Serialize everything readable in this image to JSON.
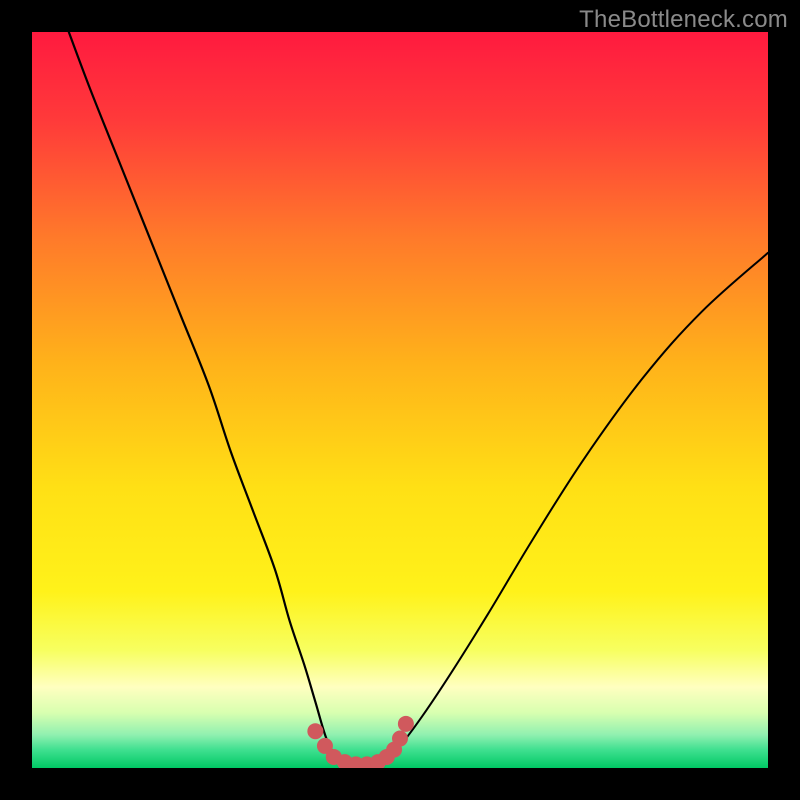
{
  "watermark": "TheBottleneck.com",
  "chart_data": {
    "type": "line",
    "title": "",
    "xlabel": "",
    "ylabel": "",
    "xlim": [
      0,
      100
    ],
    "ylim": [
      0,
      100
    ],
    "grid": false,
    "legend": false,
    "background_gradient": {
      "stops": [
        {
          "pos": 0.0,
          "color": "#ff1a3f"
        },
        {
          "pos": 0.12,
          "color": "#ff3a3a"
        },
        {
          "pos": 0.28,
          "color": "#ff7a2a"
        },
        {
          "pos": 0.45,
          "color": "#ffb21a"
        },
        {
          "pos": 0.62,
          "color": "#ffe015"
        },
        {
          "pos": 0.76,
          "color": "#fff21a"
        },
        {
          "pos": 0.84,
          "color": "#f7ff60"
        },
        {
          "pos": 0.89,
          "color": "#ffffc0"
        },
        {
          "pos": 0.925,
          "color": "#d8ffb0"
        },
        {
          "pos": 0.955,
          "color": "#90f0b0"
        },
        {
          "pos": 0.975,
          "color": "#40e090"
        },
        {
          "pos": 1.0,
          "color": "#00c864"
        }
      ]
    },
    "series": [
      {
        "name": "left-curve",
        "stroke": "#000000",
        "width": 2.2,
        "x": [
          5,
          8,
          12,
          16,
          20,
          24,
          27,
          30,
          33,
          35,
          37,
          38.5,
          40,
          41.5
        ],
        "values": [
          100,
          92,
          82,
          72,
          62,
          52,
          43,
          35,
          27,
          20,
          14,
          9,
          4,
          1
        ]
      },
      {
        "name": "right-curve",
        "stroke": "#000000",
        "width": 2.0,
        "x": [
          48,
          50,
          53,
          57,
          62,
          68,
          75,
          83,
          91,
          100
        ],
        "values": [
          1,
          3,
          7,
          13,
          21,
          31,
          42,
          53,
          62,
          70
        ]
      },
      {
        "name": "valley-dots",
        "type": "scatter",
        "stroke": "#d0595d",
        "fill": "#d0595d",
        "radius": 8,
        "x": [
          38.5,
          39.8,
          41,
          42.5,
          44,
          45.5,
          47,
          48.2,
          49.2,
          50,
          50.8
        ],
        "values": [
          5,
          3,
          1.5,
          0.8,
          0.5,
          0.5,
          0.8,
          1.5,
          2.5,
          4,
          6
        ]
      }
    ]
  }
}
